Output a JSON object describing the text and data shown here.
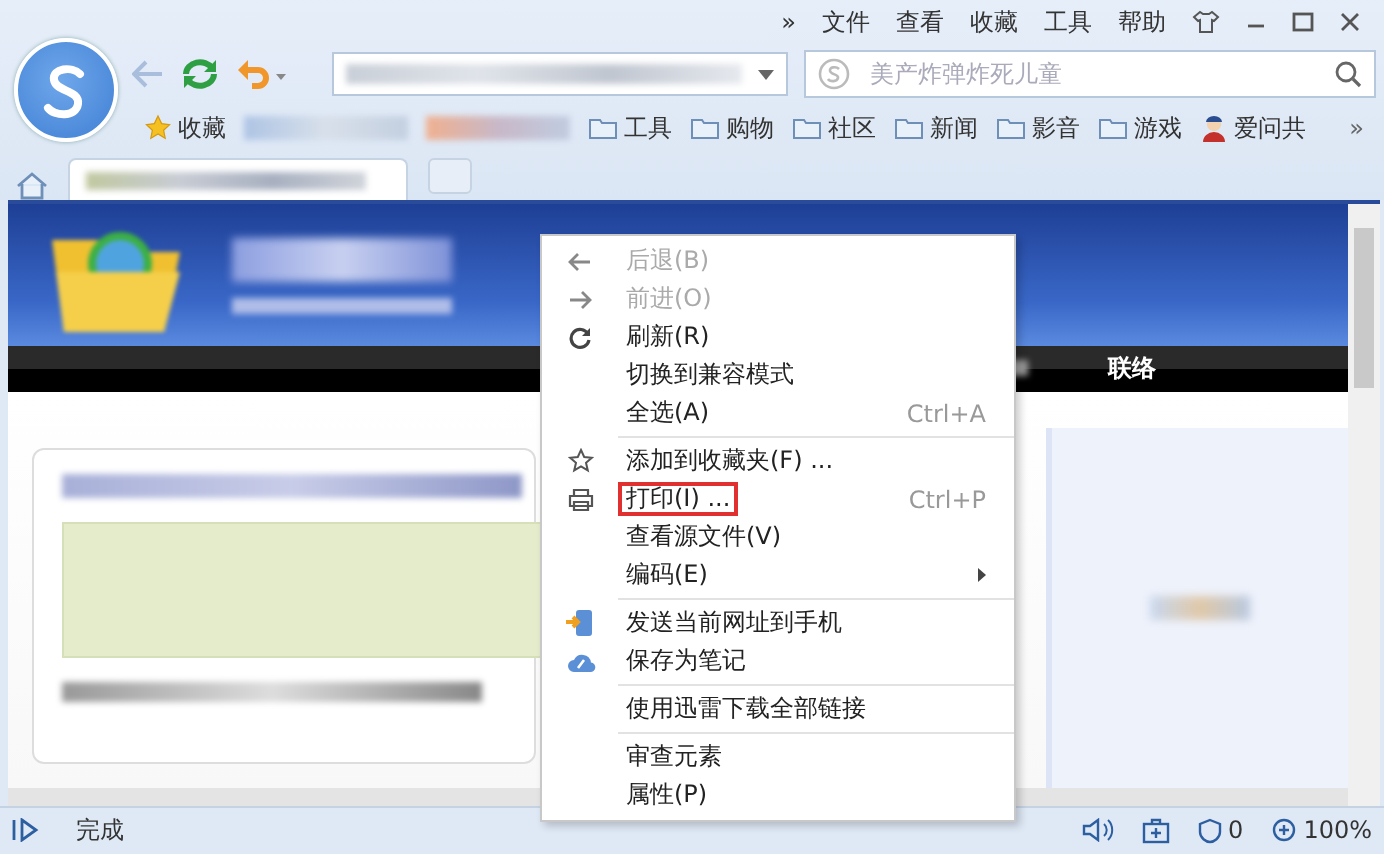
{
  "window": {
    "menu_overflow": "»",
    "menu": [
      "文件",
      "查看",
      "收藏",
      "工具",
      "帮助"
    ]
  },
  "toolbar": {
    "search": {
      "placeholder": "美产炸弹炸死儿童"
    }
  },
  "bookmarks": [
    {
      "label": "收藏",
      "kind": "star"
    },
    {
      "kind": "blurred"
    },
    {
      "kind": "blurred"
    },
    {
      "label": "工具",
      "kind": "folder"
    },
    {
      "label": "购物",
      "kind": "folder"
    },
    {
      "label": "社区",
      "kind": "folder"
    },
    {
      "label": "新闻",
      "kind": "folder"
    },
    {
      "label": "影音",
      "kind": "folder"
    },
    {
      "label": "游戏",
      "kind": "folder"
    },
    {
      "label": "爱问共",
      "kind": "person"
    }
  ],
  "bookmarks_overflow": "»",
  "page": {
    "nav_item": "联络"
  },
  "context_menu": {
    "items": [
      {
        "kind": "item",
        "label": "后退(B)",
        "disabled": true,
        "outlined": false,
        "submenu": false
      },
      {
        "kind": "item",
        "label": "前进(O)",
        "disabled": true,
        "outlined": false,
        "submenu": false
      },
      {
        "kind": "item",
        "label": "刷新(R)",
        "disabled": false,
        "outlined": false,
        "submenu": false
      },
      {
        "kind": "item",
        "label": "切换到兼容模式",
        "disabled": false,
        "outlined": false,
        "submenu": false
      },
      {
        "kind": "item",
        "label": "全选(A)",
        "shortcut": "Ctrl+A",
        "disabled": false,
        "outlined": false,
        "submenu": false
      },
      {
        "kind": "separator"
      },
      {
        "kind": "item",
        "label": "添加到收藏夹(F) ...",
        "disabled": false,
        "outlined": false,
        "submenu": false
      },
      {
        "kind": "item",
        "label": "打印(I) ...",
        "shortcut": "Ctrl+P",
        "disabled": false,
        "outlined": true,
        "submenu": false
      },
      {
        "kind": "item",
        "label": "查看源文件(V)",
        "disabled": false,
        "outlined": false,
        "submenu": false
      },
      {
        "kind": "item",
        "label": "编码(E)",
        "disabled": false,
        "outlined": false,
        "submenu": true
      },
      {
        "kind": "separator"
      },
      {
        "kind": "item",
        "label": "发送当前网址到手机",
        "disabled": false,
        "outlined": false,
        "submenu": false
      },
      {
        "kind": "item",
        "label": "保存为笔记",
        "disabled": false,
        "outlined": false,
        "submenu": false
      },
      {
        "kind": "separator"
      },
      {
        "kind": "item",
        "label": "使用迅雷下载全部链接",
        "disabled": false,
        "outlined": false,
        "submenu": false
      },
      {
        "kind": "separator"
      },
      {
        "kind": "item",
        "label": "审查元素",
        "disabled": false,
        "outlined": false,
        "submenu": false
      },
      {
        "kind": "item",
        "label": "属性(P)",
        "disabled": false,
        "outlined": false,
        "submenu": false
      }
    ]
  },
  "status_bar": {
    "text": "完成",
    "counter": "0",
    "zoom": "100%"
  }
}
